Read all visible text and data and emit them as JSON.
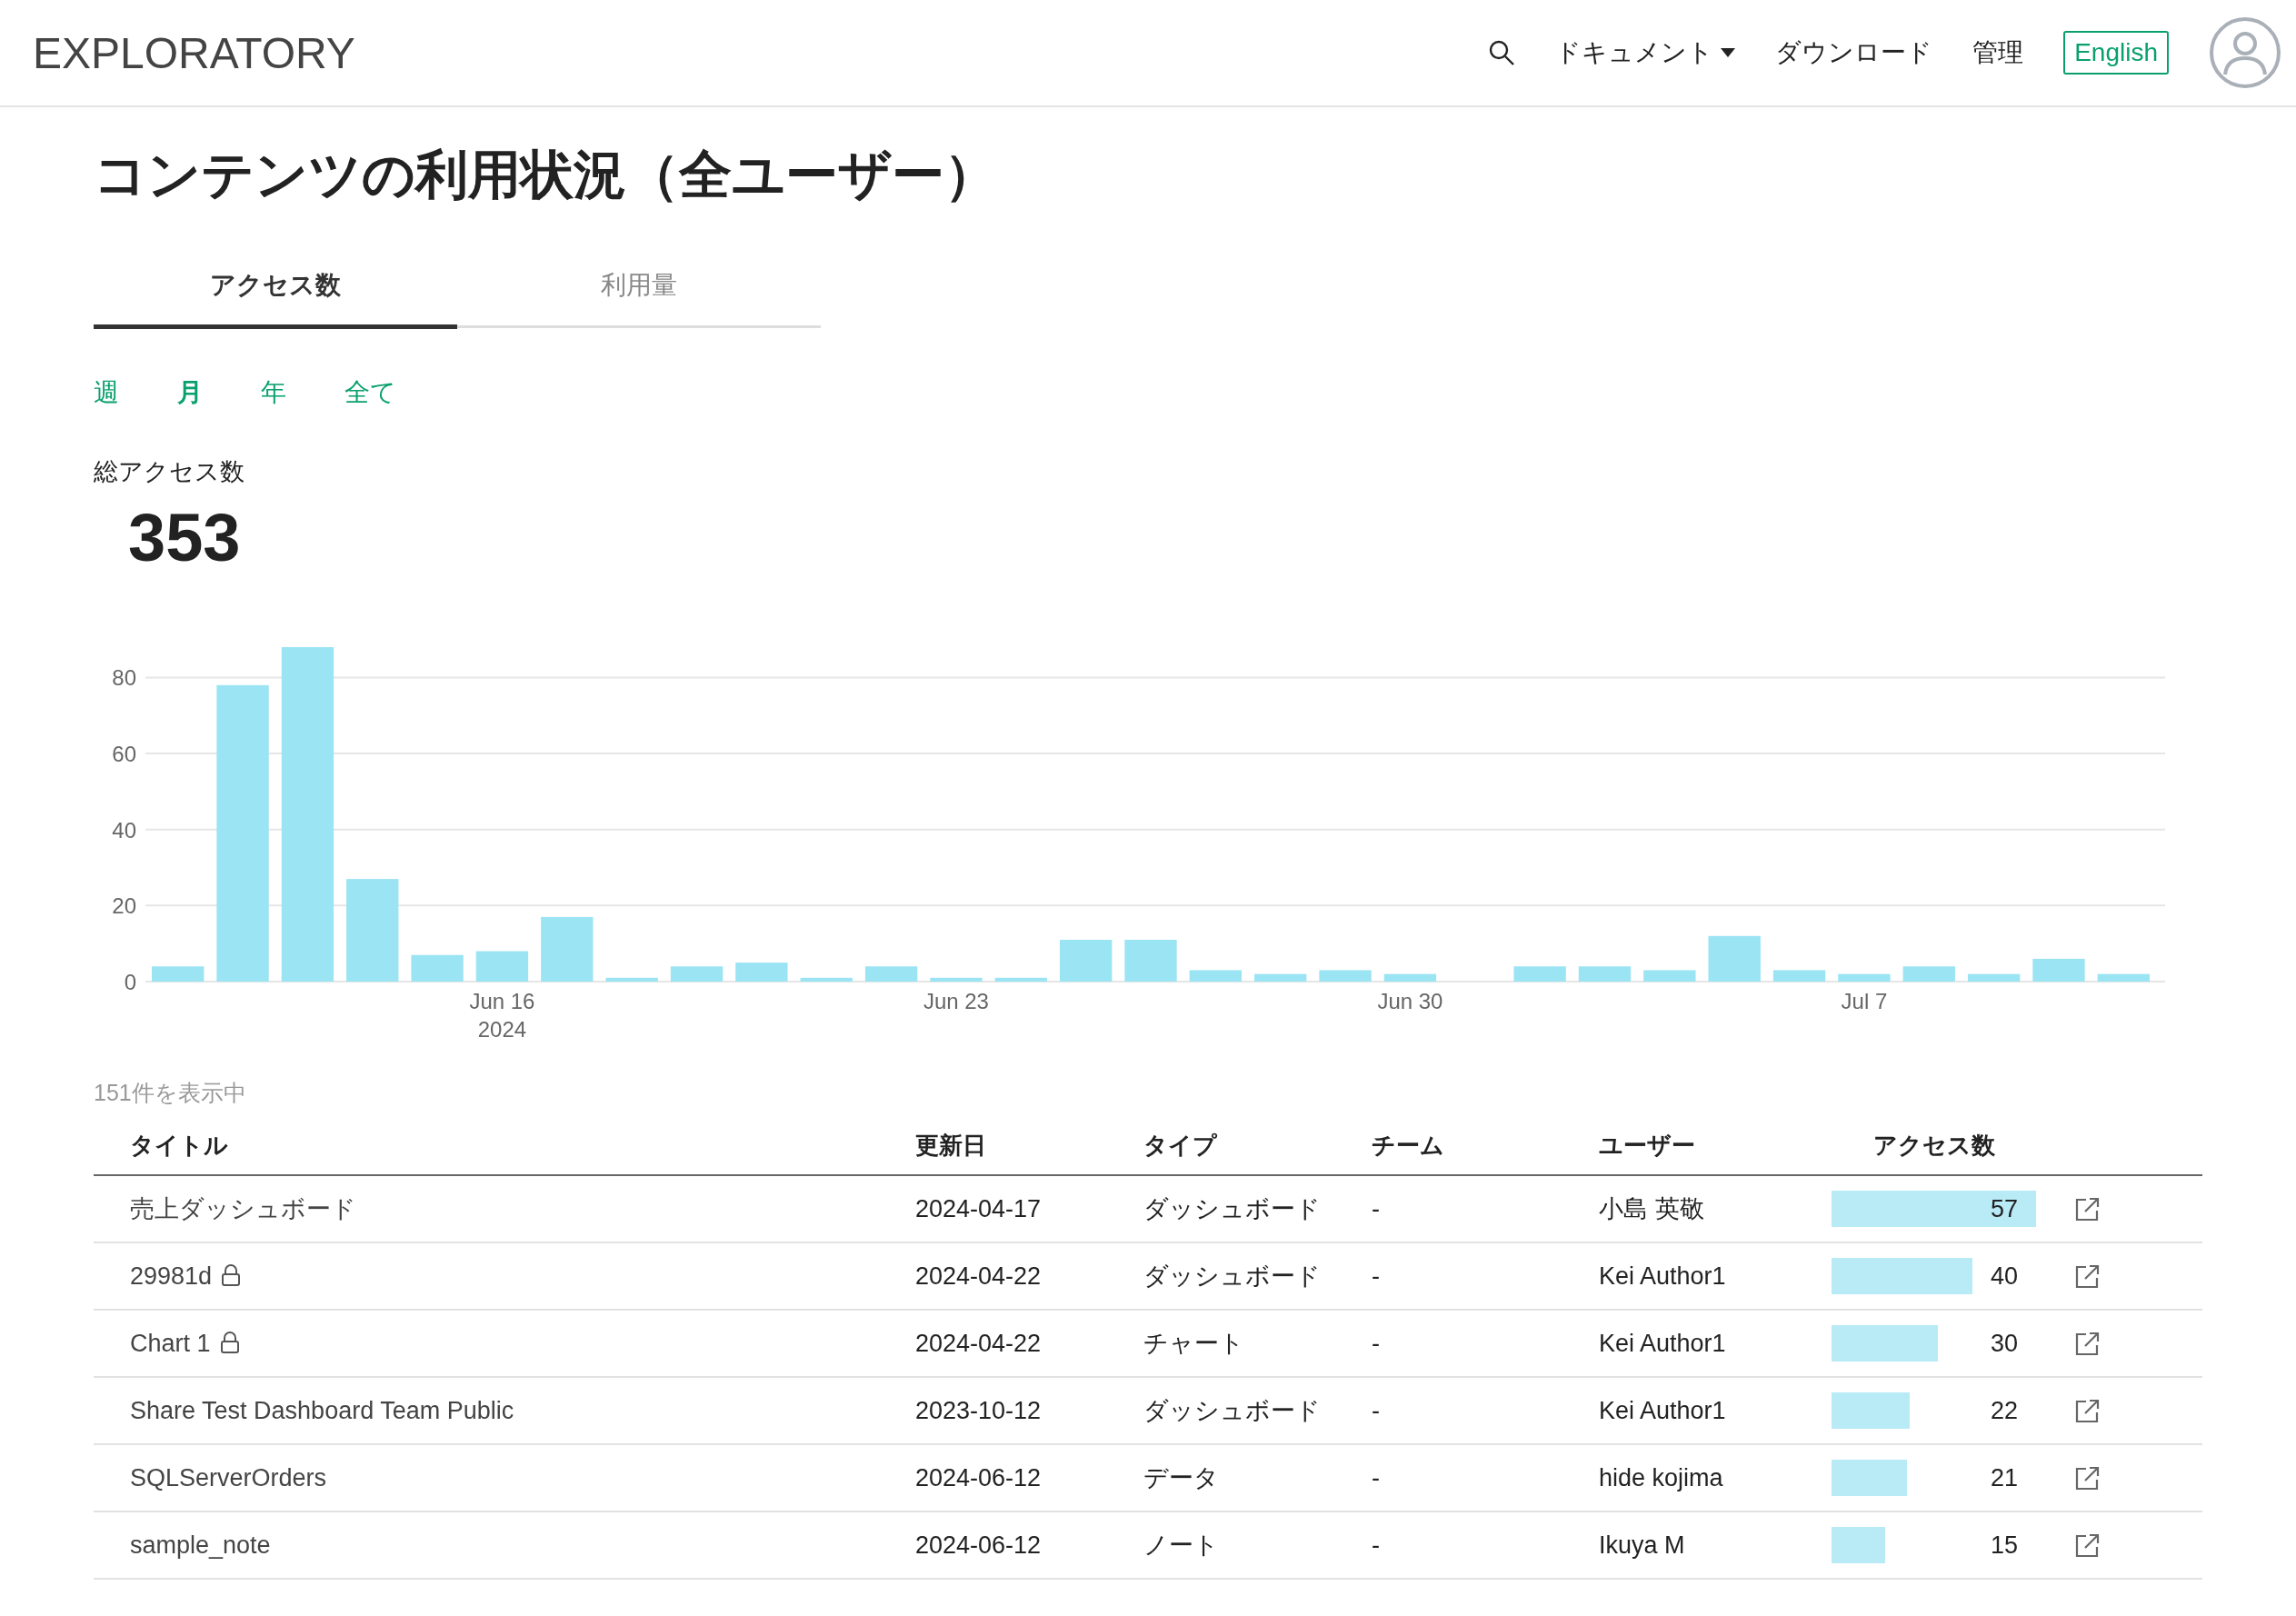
{
  "header": {
    "logo": "EXPLORATORY",
    "nav": [
      {
        "kind": "search"
      },
      {
        "kind": "dropdown",
        "label": "ドキュメント"
      },
      {
        "kind": "link",
        "label": "ダウンロード"
      },
      {
        "kind": "link",
        "label": "管理"
      },
      {
        "kind": "language",
        "label": "English"
      },
      {
        "kind": "avatar"
      }
    ]
  },
  "page_title": "コンテンツの利用状況（全ユーザー）",
  "tabs": [
    {
      "label": "アクセス数",
      "selected": true
    },
    {
      "label": "利用量",
      "selected": false
    }
  ],
  "periods": [
    {
      "label": "週",
      "selected": false
    },
    {
      "label": "月",
      "selected": true
    },
    {
      "label": "年",
      "selected": false
    },
    {
      "label": "全て",
      "selected": false
    }
  ],
  "total": {
    "label": "総アクセス数",
    "value": "353"
  },
  "chart": {
    "chart_data": {
      "type": "bar",
      "grid": true,
      "categories": [
        null,
        null,
        null,
        null,
        null,
        "Jun 16 2024",
        null,
        null,
        null,
        null,
        null,
        null,
        "Jun 23",
        null,
        null,
        null,
        null,
        null,
        null,
        "Jun 30",
        null,
        null,
        null,
        null,
        null,
        null,
        "Jul 7",
        null,
        null,
        null,
        null
      ],
      "series": [
        {
          "color": "#9be4f4",
          "values": [
            4,
            78,
            88,
            27,
            7,
            8,
            17,
            1,
            4,
            5,
            1,
            4,
            1,
            1,
            11,
            11,
            3,
            2,
            3,
            2,
            0,
            4,
            4,
            3,
            12,
            3,
            2,
            4,
            2,
            6,
            2
          ]
        }
      ],
      "ylim": [
        0,
        88
      ],
      "yticks": [
        0,
        20,
        40,
        60,
        80
      ]
    }
  },
  "table": {
    "count_label": "151件を表示中",
    "columns": [
      "タイトル",
      "更新日",
      "タイプ",
      "チーム",
      "ユーザー",
      "アクセス数"
    ],
    "rows": [
      {
        "title": "売上ダッシュボード",
        "locked": false,
        "updated": "2024-04-17",
        "type": "ダッシュボード",
        "team": "-",
        "user": "小島 英敬",
        "level": 1,
        "access": "57"
      },
      {
        "title": "29981d",
        "locked": true,
        "updated": "2024-04-22",
        "type": "ダッシュボード",
        "team": "-",
        "user": "Kei Author1",
        "level": 0.69,
        "access": "40"
      },
      {
        "title": "Chart 1",
        "locked": true,
        "updated": "2024-04-22",
        "type": "チャート",
        "team": "-",
        "user": "Kei Author1",
        "level": 0.52,
        "access": "30"
      },
      {
        "title": "Share Test Dashboard Team Public",
        "locked": false,
        "updated": "2023-10-12",
        "type": "ダッシュボード",
        "team": "-",
        "user": "Kei Author1",
        "level": 0.38,
        "access": "22"
      },
      {
        "title": "SQLServerOrders",
        "locked": false,
        "updated": "2024-06-12",
        "type": "データ",
        "team": "-",
        "user": "hide kojima",
        "level": 0.37,
        "access": "21"
      },
      {
        "title": "sample_note",
        "locked": false,
        "updated": "2024-06-12",
        "type": "ノート",
        "team": "-",
        "user": "Ikuya M",
        "level": 0.26,
        "access": "15"
      }
    ]
  }
}
